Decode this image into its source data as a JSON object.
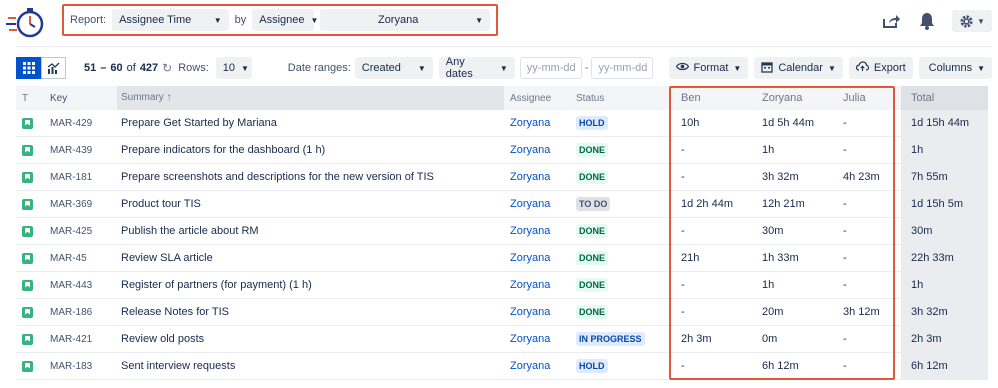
{
  "header": {
    "report_label": "Report:",
    "report_value": "Assignee Time",
    "by_label": "by",
    "group_value": "Assignee",
    "user_value": "Zoryana"
  },
  "toolbar": {
    "range_start": "51",
    "range_sep": "–",
    "range_end": "60",
    "of_label": "of",
    "total": "427",
    "rows_label": "Rows:",
    "rows_value": "10",
    "date_ranges_label": "Date ranges:",
    "date_field": "Created",
    "date_period": "Any dates",
    "date_from_placeholder": "yy-mm-dd",
    "date_dash": "-",
    "date_to_placeholder": "yy-mm-dd",
    "format_label": "Format",
    "calendar_label": "Calendar",
    "export_label": "Export",
    "columns_label": "Columns"
  },
  "table": {
    "headers": {
      "type": "T",
      "key": "Key",
      "summary": "Summary ↑",
      "assignee": "Assignee",
      "status": "Status",
      "ben": "Ben",
      "zoryana": "Zoryana",
      "julia": "Julia",
      "total": "Total"
    },
    "rows": [
      {
        "key": "MAR-429",
        "summary": "Prepare Get Started by Mariana",
        "assignee": "Zoryana",
        "status": "HOLD",
        "status_type": "hold",
        "ben": "10h",
        "zoryana": "1d 5h 44m",
        "julia": "-",
        "total": "1d 15h 44m"
      },
      {
        "key": "MAR-439",
        "summary": "Prepare indicators for the dashboard (1 h)",
        "assignee": "Zoryana",
        "status": "DONE",
        "status_type": "done",
        "ben": "-",
        "zoryana": "1h",
        "julia": "-",
        "total": "1h"
      },
      {
        "key": "MAR-181",
        "summary": "Prepare screenshots and descriptions for the new version of TIS",
        "assignee": "Zoryana",
        "status": "DONE",
        "status_type": "done",
        "ben": "-",
        "zoryana": "3h 32m",
        "julia": "4h 23m",
        "total": "7h 55m"
      },
      {
        "key": "MAR-369",
        "summary": "Product tour TIS",
        "assignee": "Zoryana",
        "status": "TO DO",
        "status_type": "todo",
        "ben": "1d 2h 44m",
        "zoryana": "12h 21m",
        "julia": "-",
        "total": "1d 15h 5m"
      },
      {
        "key": "MAR-425",
        "summary": "Publish the article about RM",
        "assignee": "Zoryana",
        "status": "DONE",
        "status_type": "done",
        "ben": "-",
        "zoryana": "30m",
        "julia": "-",
        "total": "30m"
      },
      {
        "key": "MAR-45",
        "summary": "Review SLA article",
        "assignee": "Zoryana",
        "status": "DONE",
        "status_type": "done",
        "ben": "21h",
        "zoryana": "1h 33m",
        "julia": "-",
        "total": "22h 33m"
      },
      {
        "key": "MAR-443",
        "summary": "Register of partners (for payment) (1 h)",
        "assignee": "Zoryana",
        "status": "DONE",
        "status_type": "done",
        "ben": "-",
        "zoryana": "1h",
        "julia": "-",
        "total": "1h"
      },
      {
        "key": "MAR-186",
        "summary": "Release Notes for TIS",
        "assignee": "Zoryana",
        "status": "DONE",
        "status_type": "done",
        "ben": "-",
        "zoryana": "20m",
        "julia": "3h 12m",
        "total": "3h 32m"
      },
      {
        "key": "MAR-421",
        "summary": "Review old posts",
        "assignee": "Zoryana",
        "status": "IN PROGRESS",
        "status_type": "prog",
        "ben": "2h 3m",
        "zoryana": "0m",
        "julia": "-",
        "total": "2h 3m"
      },
      {
        "key": "MAR-183",
        "summary": "Sent interview requests",
        "assignee": "Zoryana",
        "status": "HOLD",
        "status_type": "hold",
        "ben": "-",
        "zoryana": "6h 12m",
        "julia": "-",
        "total": "6h 12m"
      }
    ]
  },
  "colors": {
    "accent": "#0052cc",
    "highlight_border": "#e0573a",
    "done": "#006644",
    "hold": "#0747a6",
    "story": "#36b37e"
  }
}
